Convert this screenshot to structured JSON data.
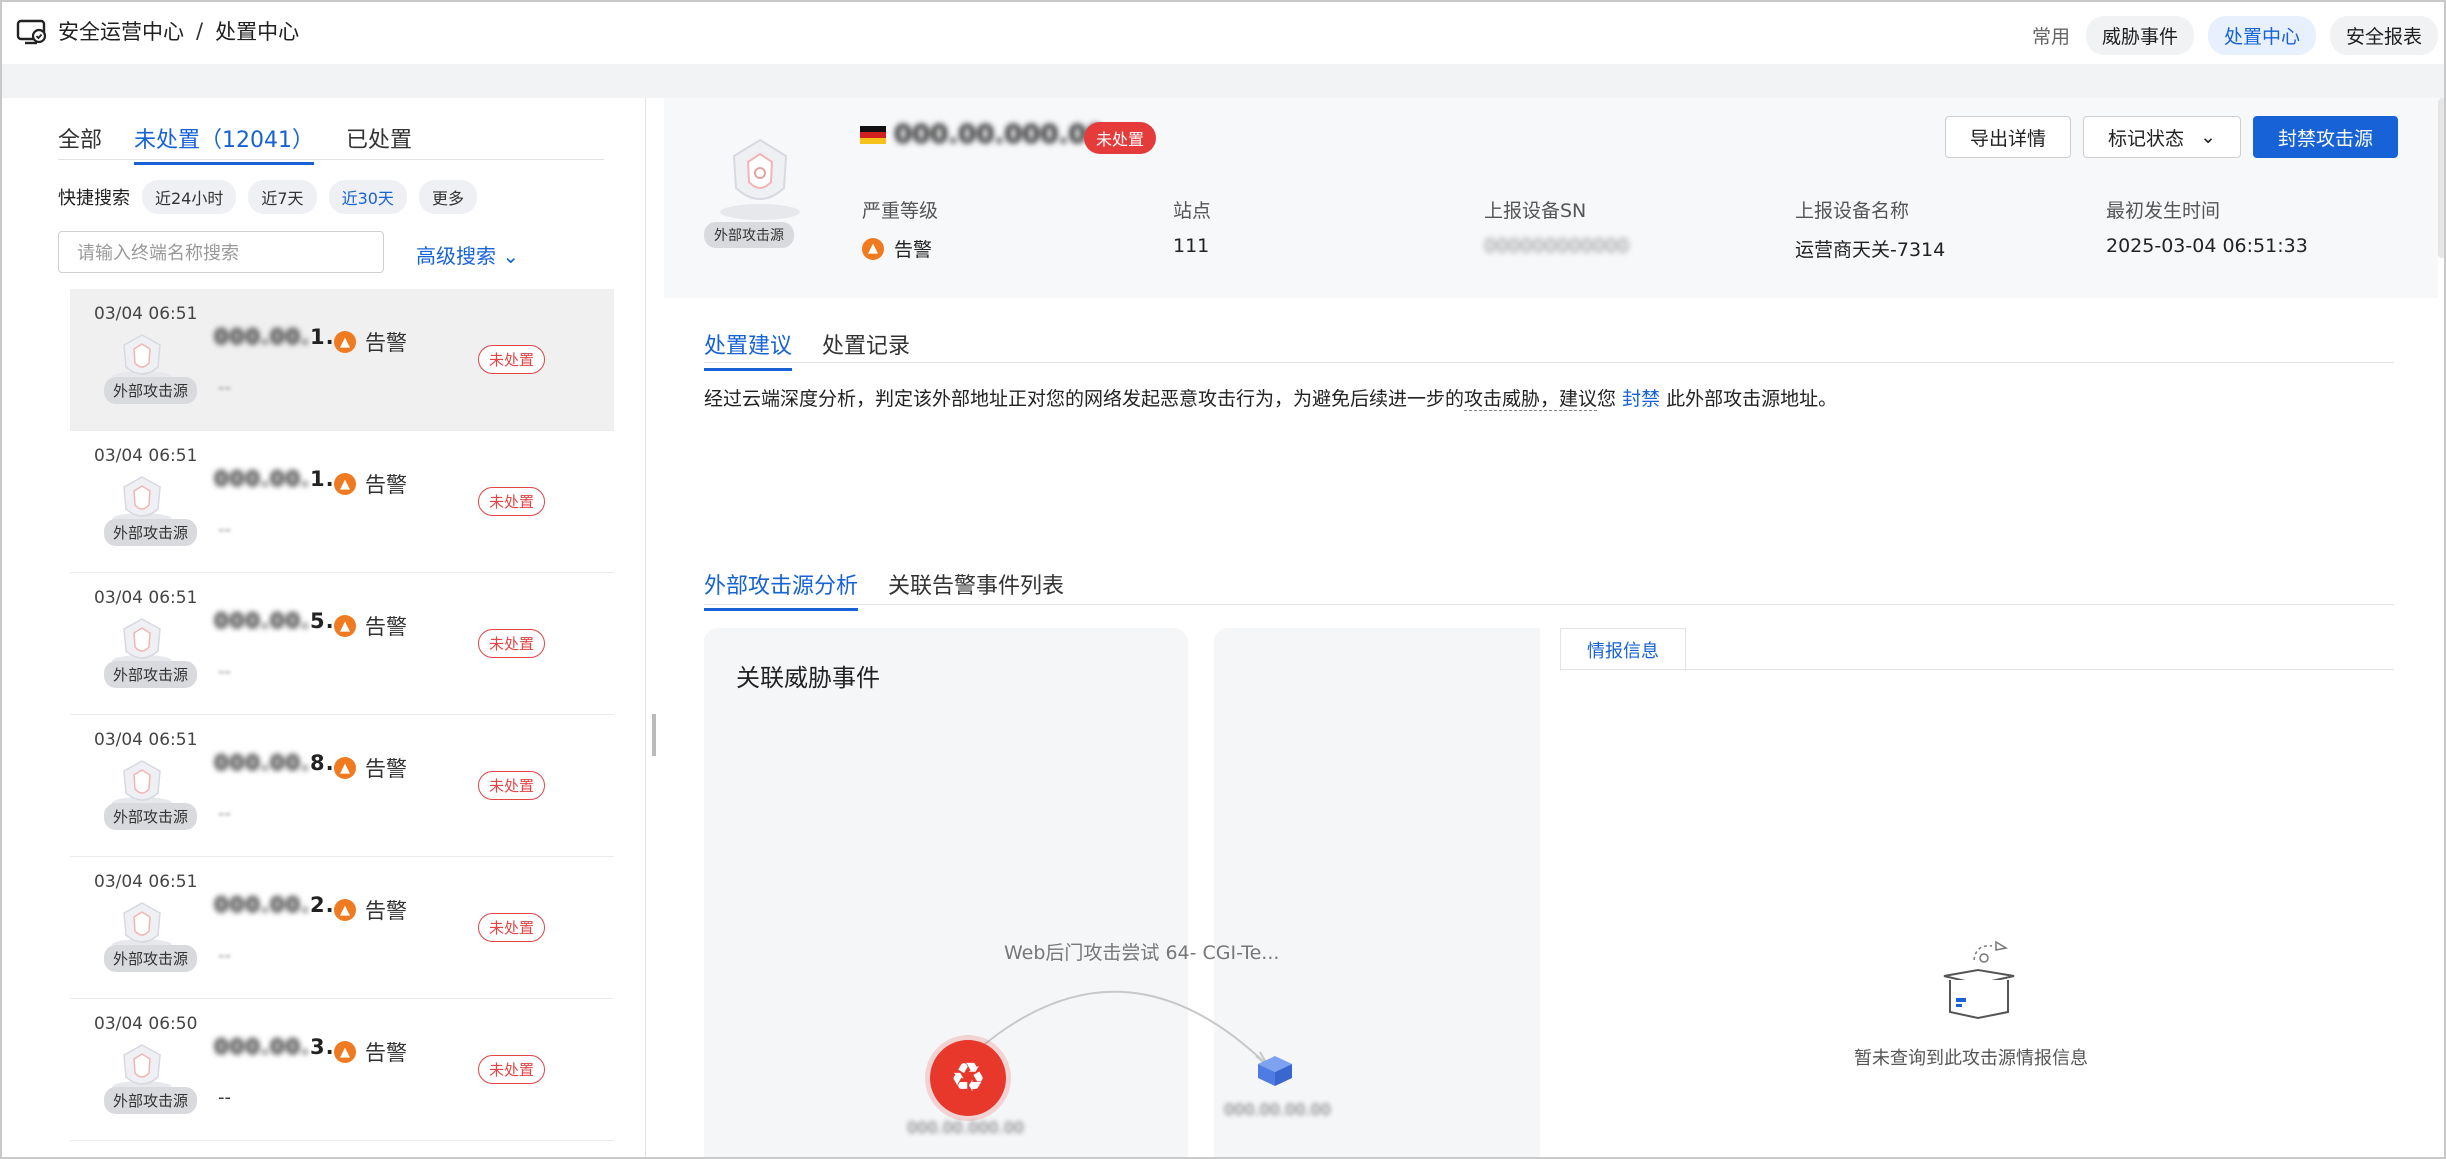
{
  "header": {
    "app_title": "安全运营中心",
    "separator": "/",
    "page_title": "处置中心",
    "quick_label": "常用",
    "quick_links": [
      "威胁事件",
      "处置中心",
      "安全报表"
    ]
  },
  "left": {
    "tabs": [
      "全部",
      "未处置（12041）",
      "已处置"
    ],
    "quick_search_label": "快捷搜索",
    "chips": [
      "近24小时",
      "近7天",
      "近30天",
      "更多"
    ],
    "search_placeholder": "请输入终端名称搜索",
    "advanced_search": "高级搜索",
    "avatar_tag": "外部攻击源",
    "level_text": "告警",
    "status_badge": "未处置",
    "rows": [
      {
        "time": "03/04 06:51",
        "ip_visible": "1",
        "sub": "--"
      },
      {
        "time": "03/04 06:51",
        "ip_visible": "1",
        "sub": "--"
      },
      {
        "time": "03/04 06:51",
        "ip_visible": "5",
        "sub": "--"
      },
      {
        "time": "03/04 06:51",
        "ip_visible": "8",
        "sub": "--"
      },
      {
        "time": "03/04 06:51",
        "ip_visible": "2",
        "sub": "--"
      },
      {
        "time": "03/04 06:50",
        "ip_visible": "3",
        "sub": "--"
      }
    ]
  },
  "detail": {
    "avatar_tag": "外部攻击源",
    "status_badge": "未处置",
    "buttons": {
      "export": "导出详情",
      "mark": "标记状态",
      "block": "封禁攻击源"
    },
    "meta": [
      {
        "k": "严重等级",
        "v": "告警"
      },
      {
        "k": "站点",
        "v": "111"
      },
      {
        "k": "上报设备SN",
        "v": ""
      },
      {
        "k": "上报设备名称",
        "v": "运营商天关-7314"
      },
      {
        "k": "最初发生时间",
        "v": "2025-03-04 06:51:33"
      }
    ],
    "tabs1": [
      "处置建议",
      "处置记录"
    ],
    "advice_pre": "经过云端深度分析，判定该外部地址正对您的网络发起恶意攻击行为，为避免后续进一步的",
    "advice_threat": "攻击威胁，建议",
    "advice_mid": "您",
    "advice_link": "封禁",
    "advice_post": "此外部攻击源地址。",
    "tabs2": [
      "外部攻击源分析",
      "关联告警事件列表"
    ],
    "graph_title": "关联威胁事件",
    "edge_label": "Web后门攻击尝试 64- CGI-Te...",
    "intel_tab": "情报信息",
    "intel_empty": "暂未查询到此攻击源情报信息"
  },
  "colors": {
    "primary": "#1662d6",
    "danger": "#e53b3b",
    "fire": "#f07a1f"
  }
}
